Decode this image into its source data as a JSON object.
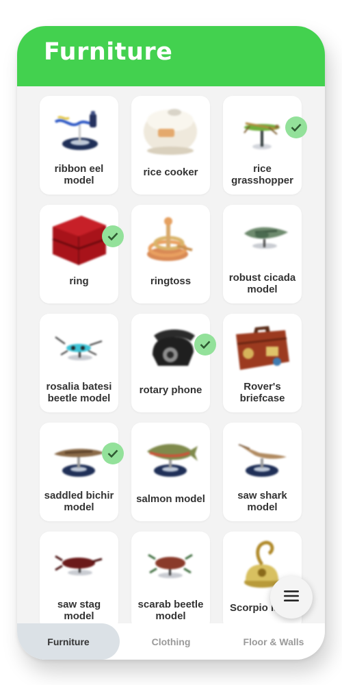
{
  "header": {
    "title": "Furniture"
  },
  "items": [
    {
      "name": "ribbon eel model",
      "icon": "ribbon-eel-model-icon",
      "checked": false
    },
    {
      "name": "rice cooker",
      "icon": "rice-cooker-icon",
      "checked": false
    },
    {
      "name": "rice grasshopper",
      "icon": "rice-grasshopper-icon",
      "checked": true
    },
    {
      "name": "ring",
      "icon": "ring-box-icon",
      "checked": true
    },
    {
      "name": "ringtoss",
      "icon": "ringtoss-icon",
      "checked": false
    },
    {
      "name": "robust cicada model",
      "icon": "robust-cicada-model-icon",
      "checked": false
    },
    {
      "name": "rosalia batesi beetle model",
      "icon": "rosalia-batesi-beetle-model-icon",
      "checked": false
    },
    {
      "name": "rotary phone",
      "icon": "rotary-phone-icon",
      "checked": true
    },
    {
      "name": "Rover's briefcase",
      "icon": "briefcase-icon",
      "checked": false
    },
    {
      "name": "saddled bichir model",
      "icon": "saddled-bichir-model-icon",
      "checked": true
    },
    {
      "name": "salmon model",
      "icon": "salmon-model-icon",
      "checked": false
    },
    {
      "name": "saw shark model",
      "icon": "saw-shark-model-icon",
      "checked": false
    },
    {
      "name": "saw stag model",
      "icon": "saw-stag-model-icon",
      "checked": false
    },
    {
      "name": "scarab beetle model",
      "icon": "scarab-beetle-model-icon",
      "checked": false
    },
    {
      "name": "Scorpio lamp",
      "icon": "scorpio-lamp-icon",
      "checked": false
    }
  ],
  "fab": {
    "icon": "menu-icon"
  },
  "tabs": [
    {
      "label": "Furniture",
      "active": true
    },
    {
      "label": "Clothing",
      "active": false
    },
    {
      "label": "Floor & Walls",
      "active": false
    }
  ],
  "colors": {
    "header": "#43d14f",
    "check": "#93e19a",
    "background": "#f3f3f3",
    "active_tab": "#dbe1e6"
  }
}
